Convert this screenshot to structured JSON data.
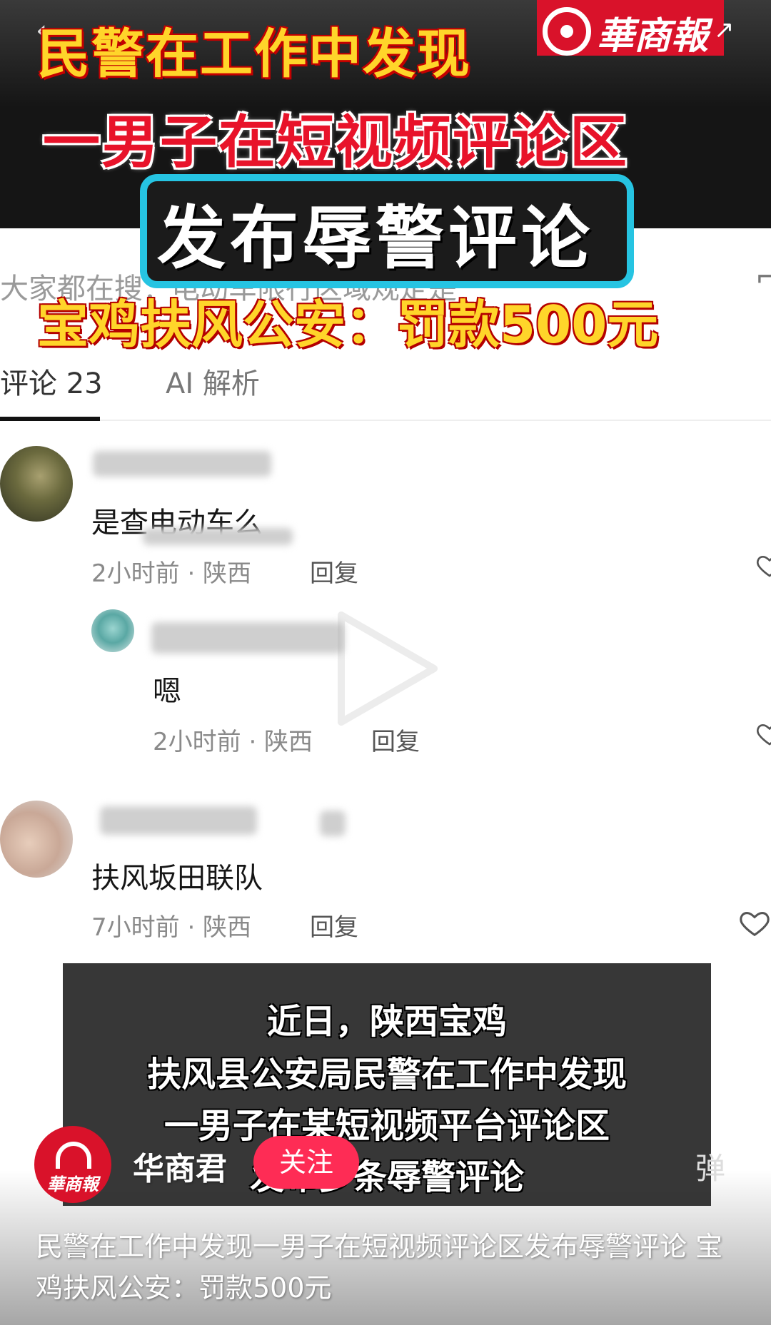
{
  "headline": {
    "line1": "民警在工作中发现",
    "line2": "一男子在短视频评论区",
    "line3": "发布辱警评论",
    "line4": "宝鸡扶风公安：罚款500元"
  },
  "logo": {
    "text": "華商報"
  },
  "search_hint": "大家都在搜：电动车限行区域规定是",
  "tabs": [
    {
      "label": "评论 23"
    },
    {
      "label": "AI 解析"
    }
  ],
  "comments": [
    {
      "text": "是查电动车么",
      "meta": "2小时前 · 陕西",
      "reply": "回复"
    },
    {
      "text": "嗯",
      "meta": "2小时前 · 陕西",
      "reply": "回复"
    },
    {
      "text": "扶风坂田联队",
      "meta": "7小时前 · 陕西",
      "reply": "回复"
    }
  ],
  "subtitle": {
    "line1": "近日，陕西宝鸡",
    "line2": "扶风县公安局民警在工作中发现",
    "line3": "一男子在某短视频平台评论区",
    "line4": "发布多条辱警评论"
  },
  "author": {
    "name": "华商君",
    "follow_label": "关注",
    "avatar_text": "華商報"
  },
  "danmu_icon": "弹",
  "caption": "民警在工作中发现一男子在短视频评论区发布辱警评论 宝鸡扶风公安：罚款500元",
  "colors": {
    "follow": "#fe2c55",
    "brand_red": "#d9122a",
    "headline_yellow": "#ffd52a",
    "headline_red": "#e8132a",
    "frame_cyan": "#26c4e2"
  }
}
